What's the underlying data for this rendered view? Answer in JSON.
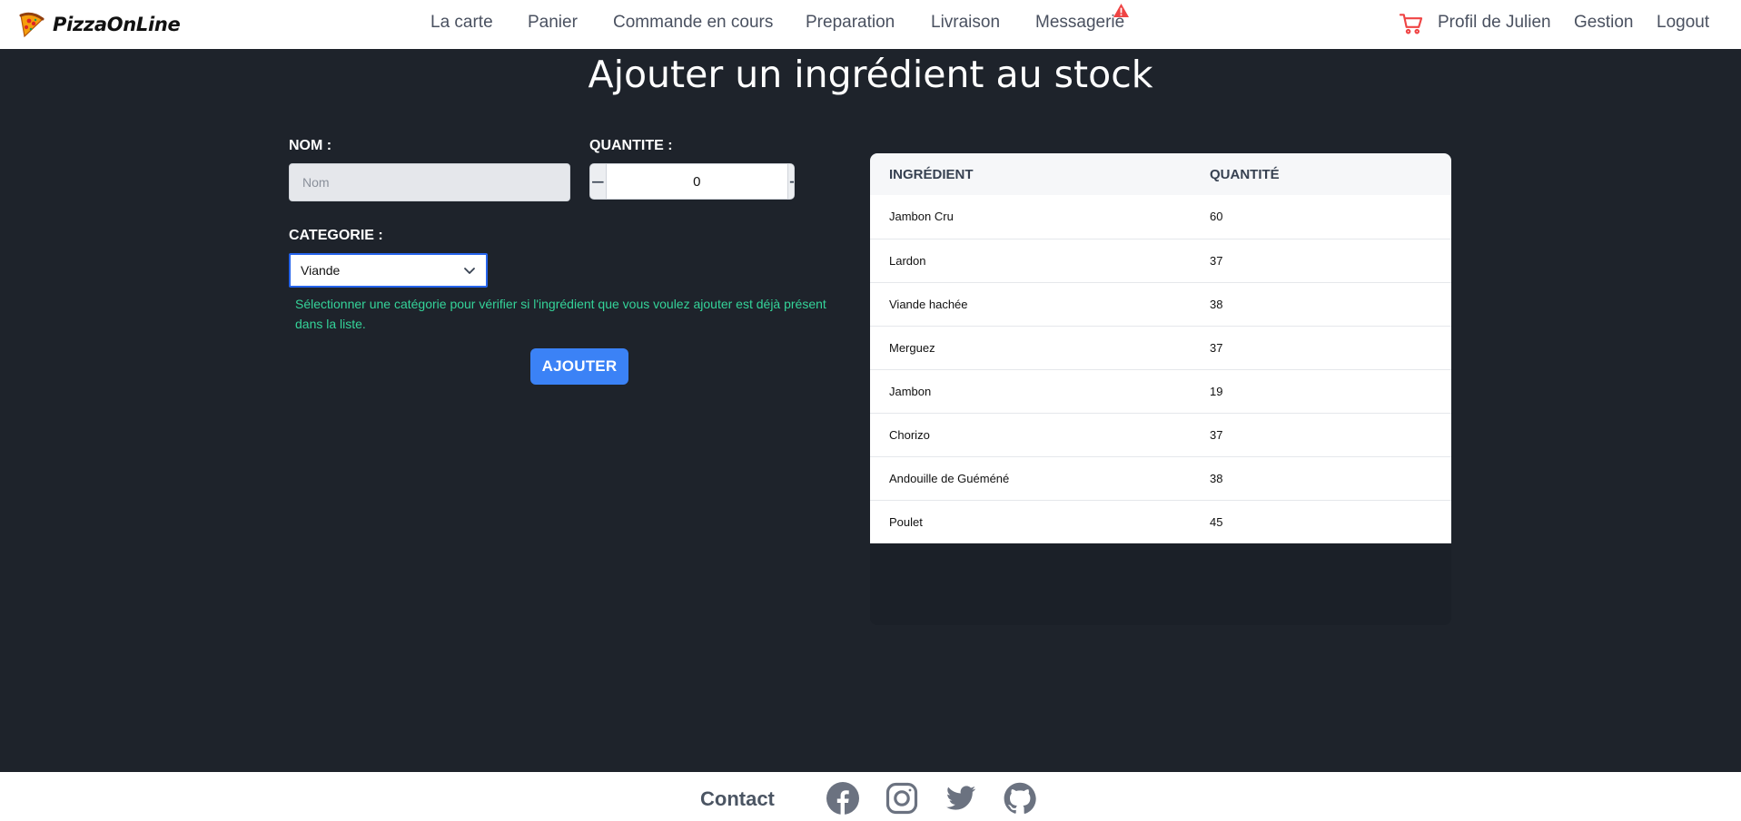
{
  "brand": {
    "name": "PizzaOnLine",
    "logo_icon": "pizza-slice-icon"
  },
  "nav": {
    "la_carte": "La carte",
    "panier": "Panier",
    "commande": "Commande en cours",
    "preparation": "Preparation",
    "livraison": "Livraison",
    "messagerie": "Messagerie",
    "alert_icon": "warning-triangle-icon",
    "cart_icon": "shopping-cart-icon",
    "profil": "Profil de Julien",
    "gestion": "Gestion",
    "logout": "Logout"
  },
  "page": {
    "title": "Ajouter un ingrédient au stock"
  },
  "form": {
    "nom_label": "NOM :",
    "nom_placeholder": "Nom",
    "nom_value": "",
    "quantite_label": "QUANTITE :",
    "quantite_value": "0",
    "minus": "−",
    "plus": "+",
    "categorie_label": "CATEGORIE :",
    "categorie_selected": "Viande",
    "hint": "Sélectionner une catégorie pour vérifier si l'ingrédient que vous voulez ajouter est déjà présent dans la liste.",
    "submit": "AJOUTER"
  },
  "table": {
    "headers": [
      "INGRÉDIENT",
      "QUANTITÉ"
    ],
    "rows": [
      {
        "name": "Jambon Cru",
        "qty": "60"
      },
      {
        "name": "Lardon",
        "qty": "37"
      },
      {
        "name": "Viande hachée",
        "qty": "38"
      },
      {
        "name": "Merguez",
        "qty": "37"
      },
      {
        "name": "Jambon",
        "qty": "19"
      },
      {
        "name": "Chorizo",
        "qty": "37"
      },
      {
        "name": "Andouille de Guéméné",
        "qty": "38"
      },
      {
        "name": "Poulet",
        "qty": "45"
      }
    ]
  },
  "footer": {
    "contact": "Contact",
    "icons": [
      "facebook-icon",
      "instagram-icon",
      "twitter-icon",
      "github-icon"
    ]
  },
  "colors": {
    "background": "#1e232b",
    "primary_button": "#3b82f6",
    "hint_text": "#34d399",
    "alert": "#ef4444",
    "cart": "#ef4444",
    "footer_icon": "#6b7280"
  }
}
